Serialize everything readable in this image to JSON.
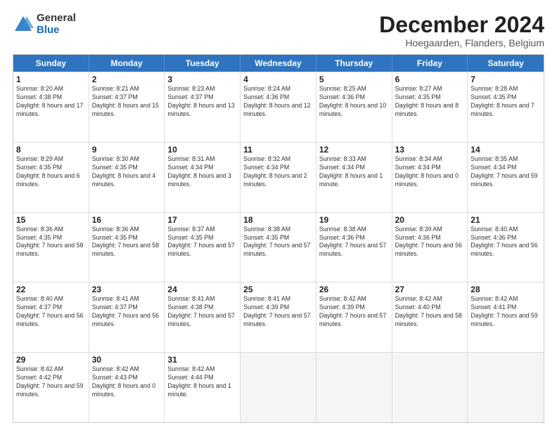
{
  "logo": {
    "general": "General",
    "blue": "Blue"
  },
  "header": {
    "month": "December 2024",
    "location": "Hoegaarden, Flanders, Belgium"
  },
  "days": [
    "Sunday",
    "Monday",
    "Tuesday",
    "Wednesday",
    "Thursday",
    "Friday",
    "Saturday"
  ],
  "weeks": [
    [
      {
        "day": "1",
        "sunrise": "Sunrise: 8:20 AM",
        "sunset": "Sunset: 4:38 PM",
        "daylight": "Daylight: 8 hours and 17 minutes."
      },
      {
        "day": "2",
        "sunrise": "Sunrise: 8:21 AM",
        "sunset": "Sunset: 4:37 PM",
        "daylight": "Daylight: 8 hours and 15 minutes."
      },
      {
        "day": "3",
        "sunrise": "Sunrise: 8:23 AM",
        "sunset": "Sunset: 4:37 PM",
        "daylight": "Daylight: 8 hours and 13 minutes."
      },
      {
        "day": "4",
        "sunrise": "Sunrise: 8:24 AM",
        "sunset": "Sunset: 4:36 PM",
        "daylight": "Daylight: 8 hours and 12 minutes."
      },
      {
        "day": "5",
        "sunrise": "Sunrise: 8:25 AM",
        "sunset": "Sunset: 4:36 PM",
        "daylight": "Daylight: 8 hours and 10 minutes."
      },
      {
        "day": "6",
        "sunrise": "Sunrise: 8:27 AM",
        "sunset": "Sunset: 4:35 PM",
        "daylight": "Daylight: 8 hours and 8 minutes."
      },
      {
        "day": "7",
        "sunrise": "Sunrise: 8:28 AM",
        "sunset": "Sunset: 4:35 PM",
        "daylight": "Daylight: 8 hours and 7 minutes."
      }
    ],
    [
      {
        "day": "8",
        "sunrise": "Sunrise: 8:29 AM",
        "sunset": "Sunset: 4:35 PM",
        "daylight": "Daylight: 8 hours and 6 minutes."
      },
      {
        "day": "9",
        "sunrise": "Sunrise: 8:30 AM",
        "sunset": "Sunset: 4:35 PM",
        "daylight": "Daylight: 8 hours and 4 minutes."
      },
      {
        "day": "10",
        "sunrise": "Sunrise: 8:31 AM",
        "sunset": "Sunset: 4:34 PM",
        "daylight": "Daylight: 8 hours and 3 minutes."
      },
      {
        "day": "11",
        "sunrise": "Sunrise: 8:32 AM",
        "sunset": "Sunset: 4:34 PM",
        "daylight": "Daylight: 8 hours and 2 minutes."
      },
      {
        "day": "12",
        "sunrise": "Sunrise: 8:33 AM",
        "sunset": "Sunset: 4:34 PM",
        "daylight": "Daylight: 8 hours and 1 minute."
      },
      {
        "day": "13",
        "sunrise": "Sunrise: 8:34 AM",
        "sunset": "Sunset: 4:34 PM",
        "daylight": "Daylight: 8 hours and 0 minutes."
      },
      {
        "day": "14",
        "sunrise": "Sunrise: 8:35 AM",
        "sunset": "Sunset: 4:34 PM",
        "daylight": "Daylight: 7 hours and 59 minutes."
      }
    ],
    [
      {
        "day": "15",
        "sunrise": "Sunrise: 8:36 AM",
        "sunset": "Sunset: 4:35 PM",
        "daylight": "Daylight: 7 hours and 58 minutes."
      },
      {
        "day": "16",
        "sunrise": "Sunrise: 8:36 AM",
        "sunset": "Sunset: 4:35 PM",
        "daylight": "Daylight: 7 hours and 58 minutes."
      },
      {
        "day": "17",
        "sunrise": "Sunrise: 8:37 AM",
        "sunset": "Sunset: 4:35 PM",
        "daylight": "Daylight: 7 hours and 57 minutes."
      },
      {
        "day": "18",
        "sunrise": "Sunrise: 8:38 AM",
        "sunset": "Sunset: 4:35 PM",
        "daylight": "Daylight: 7 hours and 57 minutes."
      },
      {
        "day": "19",
        "sunrise": "Sunrise: 8:38 AM",
        "sunset": "Sunset: 4:36 PM",
        "daylight": "Daylight: 7 hours and 57 minutes."
      },
      {
        "day": "20",
        "sunrise": "Sunrise: 8:39 AM",
        "sunset": "Sunset: 4:36 PM",
        "daylight": "Daylight: 7 hours and 56 minutes."
      },
      {
        "day": "21",
        "sunrise": "Sunrise: 8:40 AM",
        "sunset": "Sunset: 4:36 PM",
        "daylight": "Daylight: 7 hours and 56 minutes."
      }
    ],
    [
      {
        "day": "22",
        "sunrise": "Sunrise: 8:40 AM",
        "sunset": "Sunset: 4:37 PM",
        "daylight": "Daylight: 7 hours and 56 minutes."
      },
      {
        "day": "23",
        "sunrise": "Sunrise: 8:41 AM",
        "sunset": "Sunset: 4:37 PM",
        "daylight": "Daylight: 7 hours and 56 minutes."
      },
      {
        "day": "24",
        "sunrise": "Sunrise: 8:41 AM",
        "sunset": "Sunset: 4:38 PM",
        "daylight": "Daylight: 7 hours and 57 minutes."
      },
      {
        "day": "25",
        "sunrise": "Sunrise: 8:41 AM",
        "sunset": "Sunset: 4:39 PM",
        "daylight": "Daylight: 7 hours and 57 minutes."
      },
      {
        "day": "26",
        "sunrise": "Sunrise: 8:42 AM",
        "sunset": "Sunset: 4:39 PM",
        "daylight": "Daylight: 7 hours and 57 minutes."
      },
      {
        "day": "27",
        "sunrise": "Sunrise: 8:42 AM",
        "sunset": "Sunset: 4:40 PM",
        "daylight": "Daylight: 7 hours and 58 minutes."
      },
      {
        "day": "28",
        "sunrise": "Sunrise: 8:42 AM",
        "sunset": "Sunset: 4:41 PM",
        "daylight": "Daylight: 7 hours and 59 minutes."
      }
    ],
    [
      {
        "day": "29",
        "sunrise": "Sunrise: 8:42 AM",
        "sunset": "Sunset: 4:42 PM",
        "daylight": "Daylight: 7 hours and 59 minutes."
      },
      {
        "day": "30",
        "sunrise": "Sunrise: 8:42 AM",
        "sunset": "Sunset: 4:43 PM",
        "daylight": "Daylight: 8 hours and 0 minutes."
      },
      {
        "day": "31",
        "sunrise": "Sunrise: 8:42 AM",
        "sunset": "Sunset: 4:44 PM",
        "daylight": "Daylight: 8 hours and 1 minute."
      },
      null,
      null,
      null,
      null
    ]
  ]
}
